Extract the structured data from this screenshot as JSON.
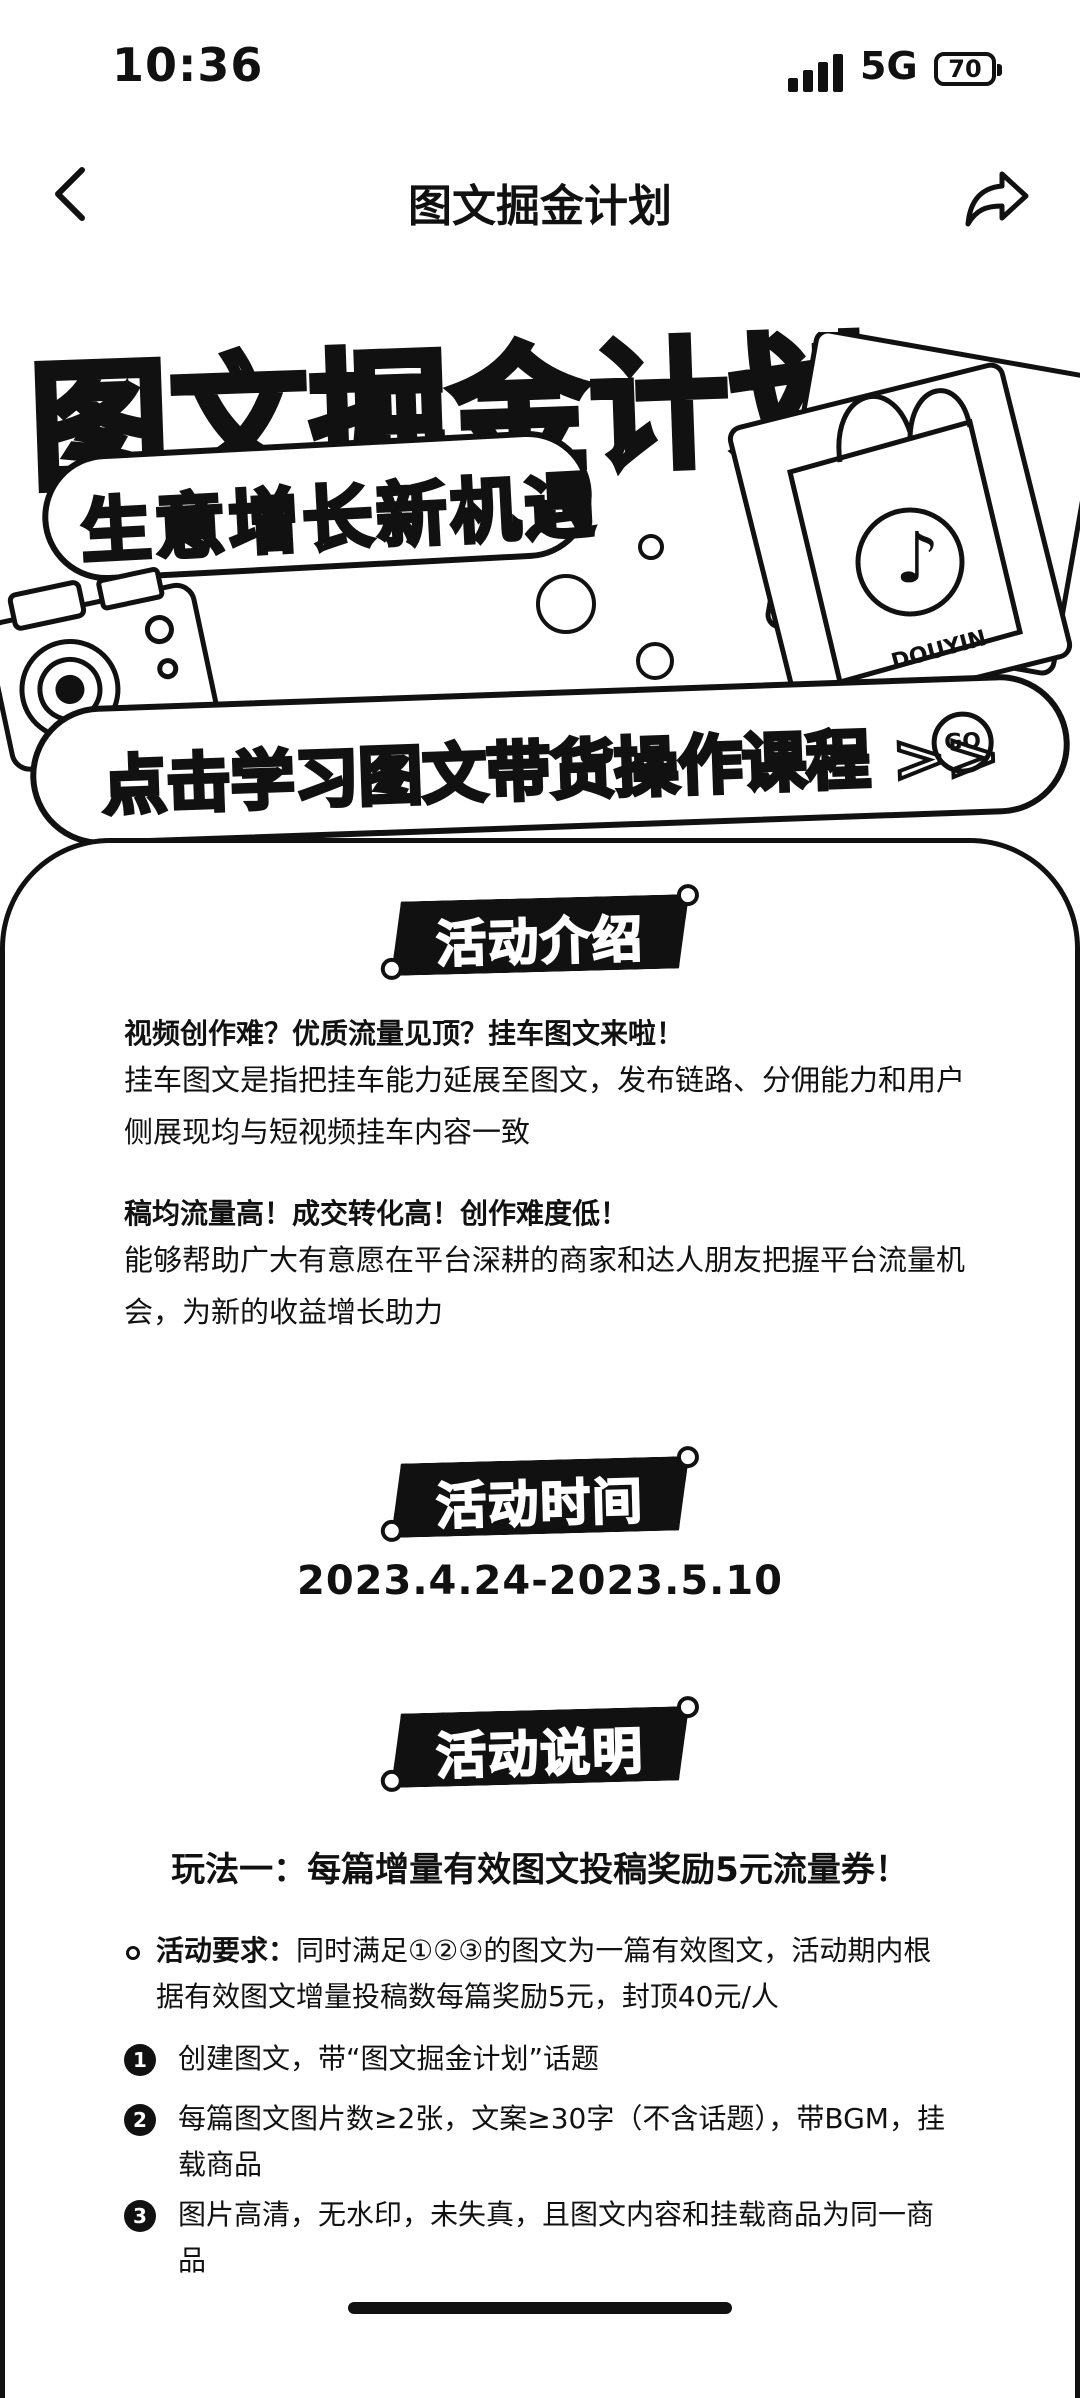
{
  "status_bar": {
    "time": "10:36",
    "network": "5G",
    "battery": "70"
  },
  "nav": {
    "back_glyph": "<",
    "title": "图文掘金计划",
    "share_icon": "share-icon"
  },
  "banner": {
    "title": "图文掘金计划",
    "subtitle": "生意增长新机遇",
    "cta_text": "点击学习图文带货操作课程 >>",
    "cta_go": "GO",
    "brand": "DOUYIN"
  },
  "intro": {
    "badge": "活动介绍",
    "heading1": "视频创作难？优质流量见顶？挂车图文来啦！",
    "body1": "挂车图文是指把挂车能力延展至图文，发布链路、分佣能力和用户侧展现均与短视频挂车内容一致",
    "heading2": "稿均流量高！成交转化高！创作难度低！",
    "body2": "能够帮助广大有意愿在平台深耕的商家和达人朋友把握平台流量机会，为新的收益增长助力"
  },
  "time_section": {
    "badge": "活动时间",
    "range": "2023.4.24-2023.5.10"
  },
  "rules": {
    "badge": "活动说明",
    "play1_title": "玩法一：每篇增量有效图文投稿奖励5元流量券！",
    "req_label": "活动要求：",
    "req_text": "同时满足①②③的图文为一篇有效图文，活动期内根据有效图文增量投稿数每篇奖励5元，封顶40元/人",
    "steps": [
      {
        "num": "1",
        "text": "创建图文，带“图文掘金计划”话题"
      },
      {
        "num": "2",
        "text": "每篇图文图片数≥2张，文案≥30字（不含话题），带BGM，挂载商品"
      },
      {
        "num": "3",
        "text": "图片高清，无水印，未失真，且图文内容和挂载商品为同一商品"
      }
    ]
  }
}
